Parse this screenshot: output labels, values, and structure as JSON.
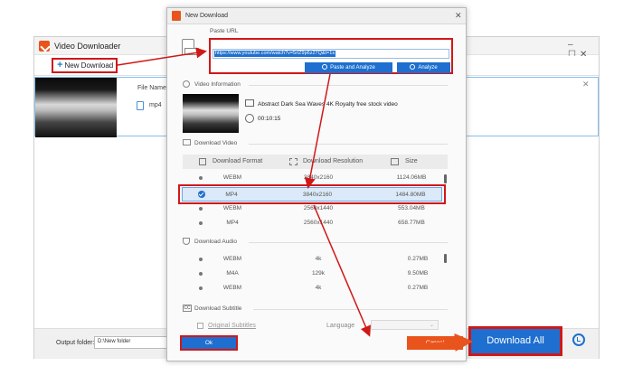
{
  "back_window": {
    "title": "Video Downloader",
    "new_download_label": "New Download",
    "file_name_label": "File Name:",
    "format_value": "mp4",
    "output_folder_label": "Output folder:",
    "output_folder_value": "D:\\New folder",
    "download_all_label": "Download All"
  },
  "dialog": {
    "title": "New Download",
    "paste_url_label": "Paste URL",
    "url_value": "https://www.youtube.com/watch?v=5rlZ9p6z27Q&t=1s",
    "paste_analyze_label": "Paste and Analyze",
    "analyze_label": "Analyze",
    "video_info_label": "Video Information",
    "video_title": "Abstract Dark Sea Waves  4K Royalty free stock video",
    "video_duration": "00:10:15",
    "download_video_label": "Download Video",
    "video_headers": {
      "format": "Download Format",
      "resolution": "Download Resolution",
      "size": "Size"
    },
    "video_rows": [
      {
        "format": "WEBM",
        "resolution": "3840x2160",
        "size": "1124.06MB",
        "selected": false
      },
      {
        "format": "MP4",
        "resolution": "3840x2160",
        "size": "1484.80MB",
        "selected": true
      },
      {
        "format": "WEBM",
        "resolution": "2560x1440",
        "size": "553.04MB",
        "selected": false
      },
      {
        "format": "MP4",
        "resolution": "2560x1440",
        "size": "658.77MB",
        "selected": false
      }
    ],
    "download_audio_label": "Download Audio",
    "audio_rows": [
      {
        "format": "WEBM",
        "bitrate": "4k",
        "size": "0.27MB"
      },
      {
        "format": "M4A",
        "bitrate": "129k",
        "size": "9.50MB"
      },
      {
        "format": "WEBM",
        "bitrate": "4k",
        "size": "0.27MB"
      }
    ],
    "download_subtitle_label": "Download Subtitle",
    "original_subtitles_label": "Original Subtitles",
    "language_label": "Language",
    "ok_label": "Ok",
    "cancel_label": "Cancel"
  },
  "colors": {
    "accent": "#1e6fcf",
    "highlight_box": "#d01818",
    "brand": "#e8541c"
  }
}
